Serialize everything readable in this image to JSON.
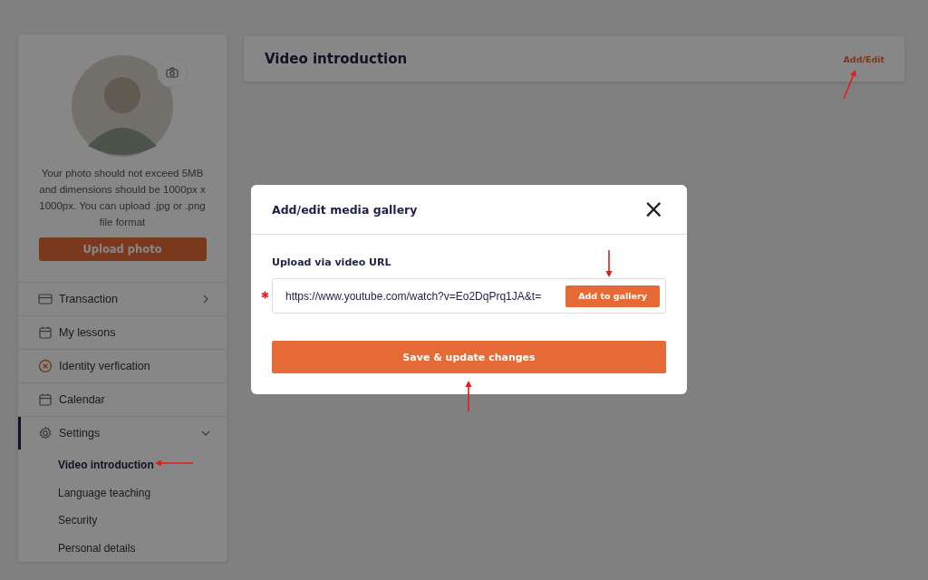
{
  "sidebar": {
    "photo_hint": "Your photo should not exceed 5MB and dimensions should be 1000px x 1000px. You can upload .jpg or .png file format",
    "upload_button": "Upload photo",
    "items": [
      {
        "label": "Transaction",
        "kind": "group",
        "expanded": false,
        "selected": false
      },
      {
        "label": "My lessons",
        "kind": "link",
        "selected": false
      },
      {
        "label": "Identity verfication",
        "kind": "link",
        "selected": false
      },
      {
        "label": "Calendar",
        "kind": "link",
        "selected": false
      },
      {
        "label": "Settings",
        "kind": "group",
        "expanded": true,
        "selected": true,
        "children": [
          {
            "label": "Video introduction",
            "selected": true
          },
          {
            "label": "Language teaching",
            "selected": false
          },
          {
            "label": "Security",
            "selected": false
          },
          {
            "label": "Personal details",
            "selected": false
          }
        ]
      }
    ]
  },
  "header": {
    "title": "Video introduction",
    "action": "Add/Edit"
  },
  "modal": {
    "title": "Add/edit media gallery",
    "close": "×",
    "field_label": "Upload via video URL",
    "required": true,
    "url_value": "https://www.youtube.com/watch?v=Eo2DqPrq1JA&t=",
    "add_button": "Add to gallery",
    "save_button": "Save & update changes"
  }
}
